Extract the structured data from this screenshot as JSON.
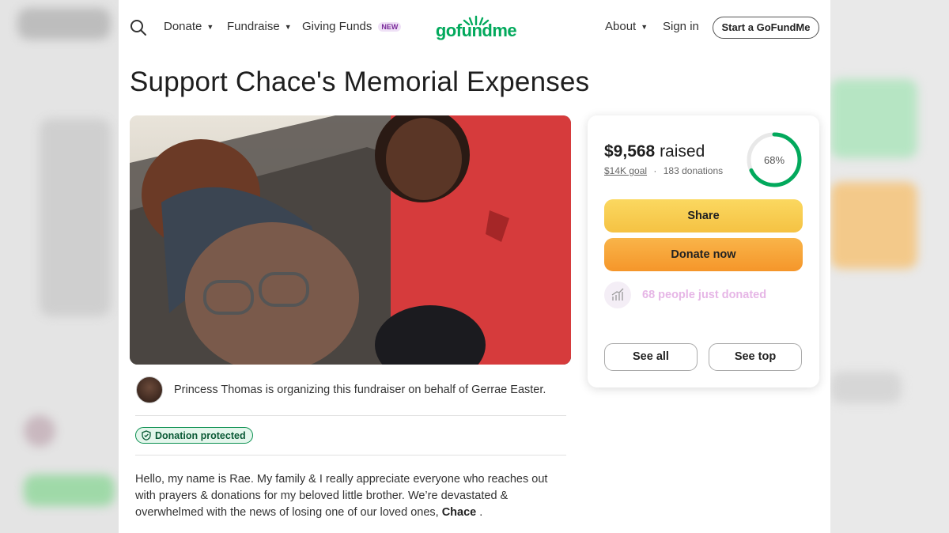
{
  "nav": {
    "donate_label": "Donate",
    "fundraise_label": "Fundraise",
    "giving_funds_label": "Giving Funds",
    "new_badge": "NEW",
    "logo_text": "gofundme",
    "about_label": "About",
    "sign_in_label": "Sign in",
    "start_label": "Start a GoFundMe",
    "caret": "▼"
  },
  "campaign": {
    "title": "Support Chace's Memorial Expenses",
    "organizer_text": "Princess Thomas is organizing this fundraiser on behalf of Gerrae Easter.",
    "protected_label": "Donation protected",
    "story_text": "Hello, my name is Rae. My family & I really appreciate everyone who reaches out with prayers & donations for my beloved little brother. We’re devastated & overwhelmed with the news of losing one of our loved ones,",
    "story_bold": "Chace",
    "story_end": " ."
  },
  "donation": {
    "raised_amount": "$9,568",
    "raised_label": " raised",
    "goal": "$14K goal",
    "separator": "·",
    "donations_count": "183 donations",
    "progress_percent": 68,
    "progress_label": "68%",
    "share_label": "Share",
    "donate_label": "Donate now",
    "recent_text": "68 people just donated",
    "see_all_label": "See all",
    "see_top_label": "See top"
  },
  "colors": {
    "brand_green": "#02a95c",
    "share_yellow": "#f5c243",
    "donate_orange": "#f5962a",
    "recent_pink": "#e6b6e6"
  }
}
